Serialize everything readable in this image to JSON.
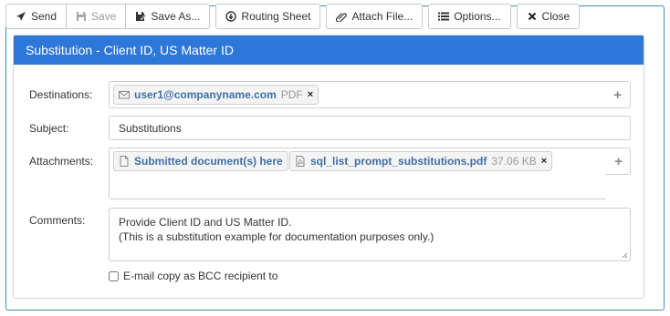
{
  "toolbar": {
    "send_label": "Send",
    "save_label": "Save",
    "save_as_label": "Save As...",
    "routing_label": "Routing Sheet",
    "attach_label": "Attach File...",
    "options_label": "Options...",
    "close_label": "Close"
  },
  "panel": {
    "title": "Substitution - Client ID, US Matter ID"
  },
  "destinations": {
    "label": "Destinations:",
    "email": "user1@companyname.com",
    "format": "PDF",
    "remove": "×",
    "add": "+"
  },
  "subject": {
    "label": "Subject:",
    "value": "Substitutions"
  },
  "attachments": {
    "label": "Attachments:",
    "items": [
      {
        "name": "Submitted document(s) here"
      },
      {
        "name": "sql_list_prompt_substitutions.pdf",
        "size": "37.06 KB",
        "remove": "×"
      }
    ],
    "add": "+"
  },
  "comments": {
    "label": "Comments:",
    "line1": "Provide Client ID and US Matter ID.",
    "line2": "(This is a substitution example for documentation purposes only.)"
  },
  "bcc": {
    "label": "E-mail copy as BCC recipient to",
    "checked": false
  },
  "colors": {
    "header": "#2d77d9",
    "frame": "#3a8fc4",
    "link": "#3f6fa6"
  }
}
